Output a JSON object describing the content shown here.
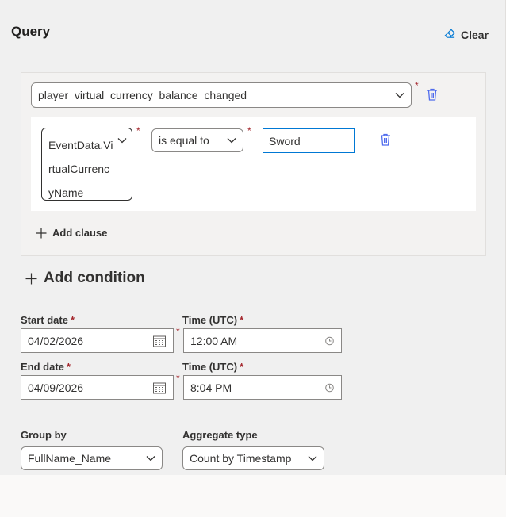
{
  "header": {
    "title": "Query",
    "clear_label": "Clear"
  },
  "query": {
    "event_dropdown": {
      "value": "player_virtual_currency_balance_changed"
    },
    "clause": {
      "field": [
        "EventData.Vi",
        "rtualCurrenc",
        "yName"
      ],
      "operator": "is equal to",
      "value": "Sword"
    },
    "add_clause_label": "Add clause",
    "required_marker": "*"
  },
  "add_condition_label": "Add condition",
  "dates": {
    "start_label": "Start date",
    "start_value": "04/02/2026",
    "start_time_label": "Time (UTC)",
    "start_time_value": "12:00 AM",
    "end_label": "End date",
    "end_value": "04/09/2026",
    "end_time_label": "Time (UTC)",
    "end_time_value": "8:04 PM",
    "required_marker": "*"
  },
  "grouping": {
    "group_by_label": "Group by",
    "group_by_value": "FullName_Name",
    "aggregate_label": "Aggregate type",
    "aggregate_value": "Count by Timestamp"
  },
  "icons": {
    "clear": "eraser-icon",
    "delete": "trash-icon",
    "add": "plus-icon",
    "dropdown": "chevron-down-icon",
    "calendar": "calendar-icon",
    "clock": "clock-icon"
  },
  "colors": {
    "required": "#a4262c",
    "focus_border": "#0078d4",
    "delete_icon": "#4f6bed"
  }
}
